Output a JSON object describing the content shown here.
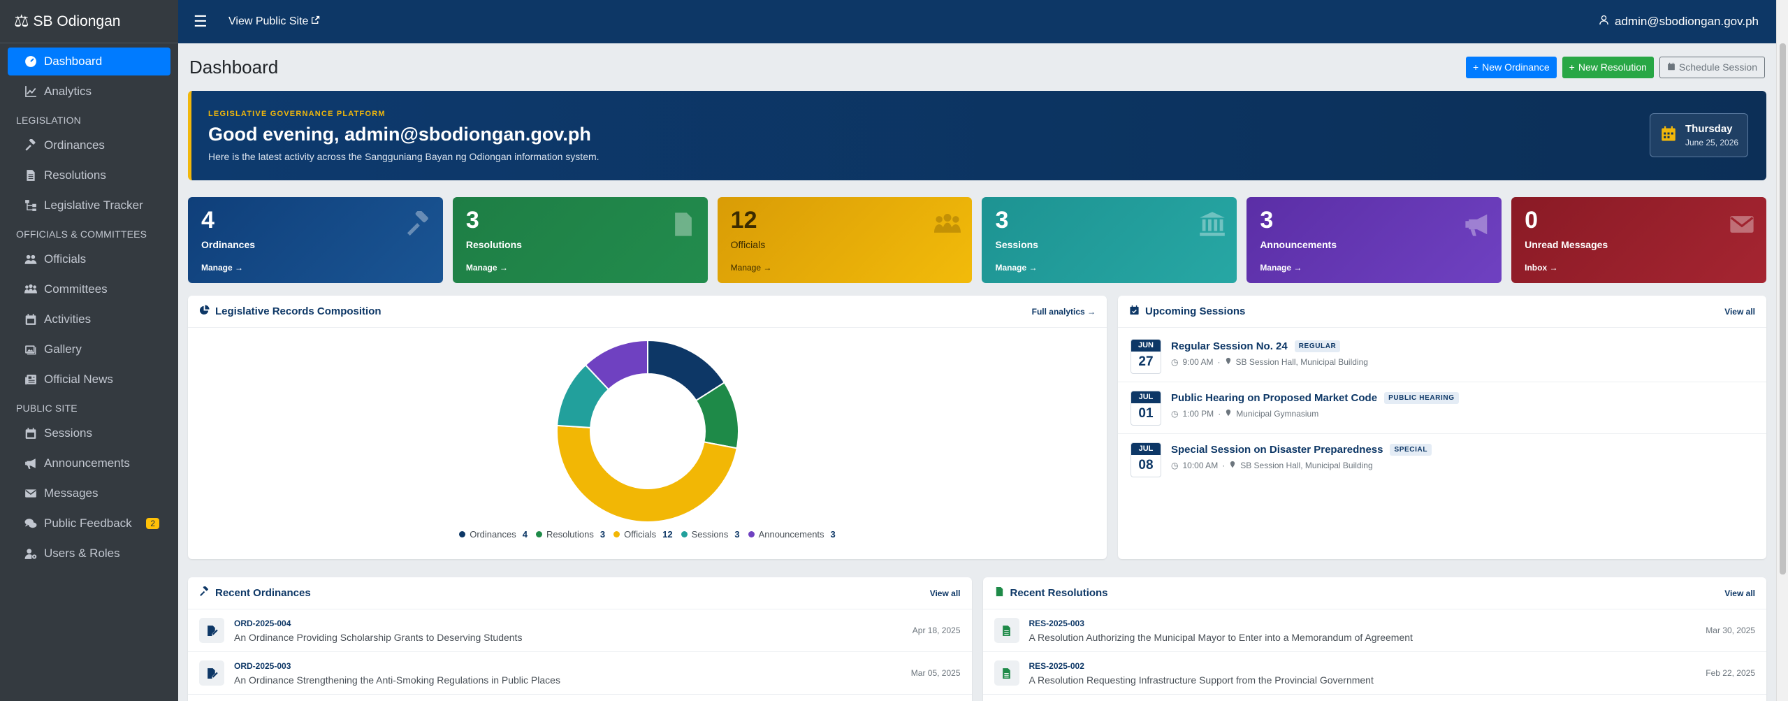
{
  "brand": {
    "name": "SB Odiongan"
  },
  "topbar": {
    "view_site": "View Public Site",
    "user": "admin@sbodiongan.gov.ph"
  },
  "sidebar": {
    "dashboard": "Dashboard",
    "analytics": "Analytics",
    "h_legislation": "LEGISLATION",
    "ordinances": "Ordinances",
    "resolutions": "Resolutions",
    "tracker": "Legislative Tracker",
    "h_officials": "OFFICIALS & COMMITTEES",
    "officials": "Officials",
    "committees": "Committees",
    "activities": "Activities",
    "gallery": "Gallery",
    "news": "Official News",
    "h_public": "PUBLIC SITE",
    "sessions": "Sessions",
    "announcements": "Announcements",
    "messages": "Messages",
    "feedback": "Public Feedback",
    "feedback_count": "2",
    "users": "Users & Roles"
  },
  "page": {
    "title": "Dashboard",
    "btn_ordinance": "New Ordinance",
    "btn_resolution": "New Resolution",
    "btn_schedule": "Schedule Session"
  },
  "hero": {
    "kicker": "LEGISLATIVE GOVERNANCE PLATFORM",
    "greeting": "Good evening, admin@sbodiongan.gov.ph",
    "subtitle": "Here is the latest activity across the Sangguniang Bayan ng Odiongan information system.",
    "day": "Thursday",
    "date": "June 25, 2026"
  },
  "stats": [
    {
      "num": "4",
      "label": "Ordinances",
      "link": "Manage →"
    },
    {
      "num": "3",
      "label": "Resolutions",
      "link": "Manage →"
    },
    {
      "num": "12",
      "label": "Officials",
      "link": "Manage →"
    },
    {
      "num": "3",
      "label": "Sessions",
      "link": "Manage →"
    },
    {
      "num": "3",
      "label": "Announcements",
      "link": "Manage →"
    },
    {
      "num": "0",
      "label": "Unread Messages",
      "link": "Inbox →"
    }
  ],
  "composition": {
    "title": "Legislative Records Composition",
    "link": "Full analytics →"
  },
  "chart_data": {
    "type": "pie",
    "categories": [
      "Ordinances",
      "Resolutions",
      "Officials",
      "Sessions",
      "Announcements"
    ],
    "values": [
      4,
      3,
      12,
      3,
      3
    ],
    "colors": [
      "#0d3766",
      "#1e8a48",
      "#f2b705",
      "#22a09c",
      "#6f41c1"
    ],
    "donut": true,
    "legend": "bottom"
  },
  "upcoming": {
    "title": "Upcoming Sessions",
    "link": "View all",
    "items": [
      {
        "month": "JUN",
        "day": "27",
        "title": "Regular Session No. 24",
        "tag": "REGULAR",
        "time": "9:00 AM",
        "place": "SB Session Hall, Municipal Building"
      },
      {
        "month": "JUL",
        "day": "01",
        "title": "Public Hearing on Proposed Market Code",
        "tag": "PUBLIC HEARING",
        "time": "1:00 PM",
        "place": "Municipal Gymnasium"
      },
      {
        "month": "JUL",
        "day": "08",
        "title": "Special Session on Disaster Preparedness",
        "tag": "SPECIAL",
        "time": "10:00 AM",
        "place": "SB Session Hall, Municipal Building"
      }
    ]
  },
  "recent_ordinances": {
    "title": "Recent Ordinances",
    "link": "View all",
    "items": [
      {
        "code": "ORD-2025-004",
        "title": "An Ordinance Providing Scholarship Grants to Deserving Students",
        "date": "Apr 18, 2025"
      },
      {
        "code": "ORD-2025-003",
        "title": "An Ordinance Strengthening the Anti-Smoking Regulations in Public Places",
        "date": "Mar 05, 2025"
      }
    ]
  },
  "recent_resolutions": {
    "title": "Recent Resolutions",
    "link": "View all",
    "items": [
      {
        "code": "RES-2025-003",
        "title": "A Resolution Authorizing the Municipal Mayor to Enter into a Memorandum of Agreement",
        "date": "Mar 30, 2025"
      },
      {
        "code": "RES-2025-002",
        "title": "A Resolution Requesting Infrastructure Support from the Provincial Government",
        "date": "Feb 22, 2025"
      }
    ]
  }
}
